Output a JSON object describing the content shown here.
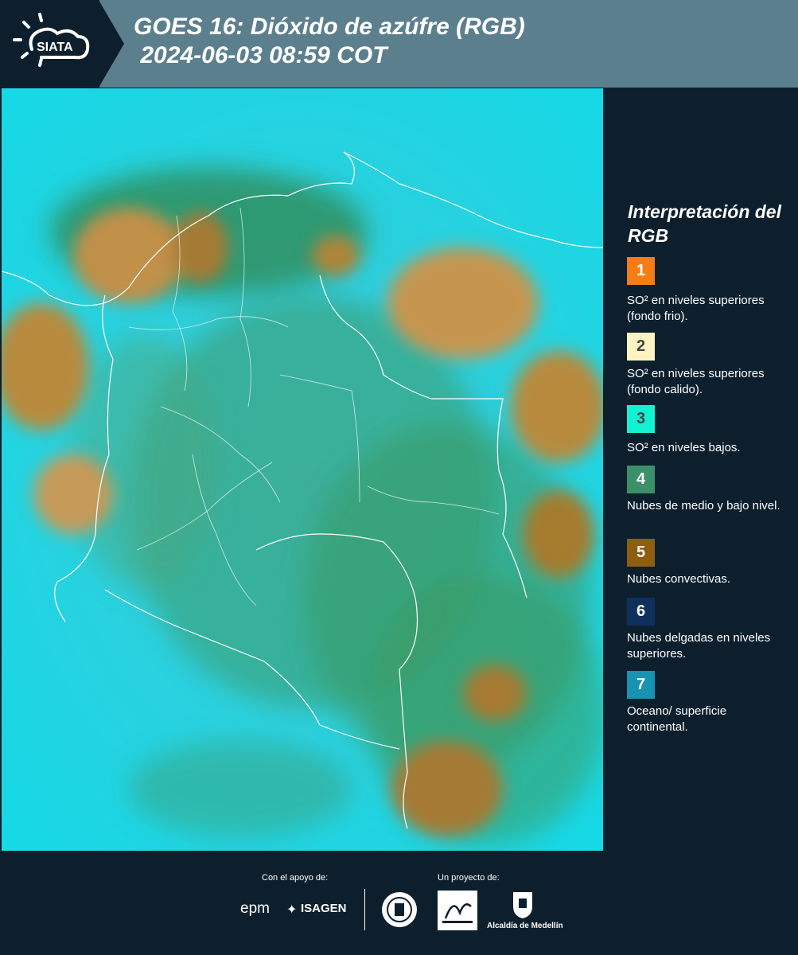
{
  "header": {
    "logo_text": "SIATA",
    "title_line1": "GOES 16: Dióxido de azúfre (RGB)",
    "title_line2": " 2024-06-03 08:59 COT"
  },
  "legend": {
    "title": "Interpretación del RGB",
    "items": [
      {
        "number": "1",
        "color": "#f57d14",
        "label": "SO² en niveles superiores (fondo frio)."
      },
      {
        "number": "2",
        "color": "#fbf3c2",
        "label": "SO² en niveles superiores (fondo calido)."
      },
      {
        "number": "3",
        "color": "#12f2d2",
        "label": "SO² en niveles bajos."
      },
      {
        "number": "4",
        "color": "#3a9067",
        "label": "Nubes de medio y bajo nivel."
      },
      {
        "number": "5",
        "color": "#8f5d0e",
        "label": "Nubes convectivas."
      },
      {
        "number": "6",
        "color": "#0f2f5c",
        "label": "Nubes delgadas en niveles superiores."
      },
      {
        "number": "7",
        "color": "#1893b4",
        "label": "Oceano/ superficie continental."
      }
    ]
  },
  "footer": {
    "support_label": "Con el apoyo de:",
    "project_label": "Un proyecto de:",
    "sponsors": [
      "epm",
      "ISAGEN"
    ],
    "partners": [
      "Área Metropolitana Valle de Aburrá",
      "Alcaldía de Medellín"
    ]
  },
  "map": {
    "ocean_color": "#22d4e0",
    "cloud_color": "#b98838",
    "low_cloud_color": "#2f9f6f",
    "border_color": "#ffffff"
  }
}
